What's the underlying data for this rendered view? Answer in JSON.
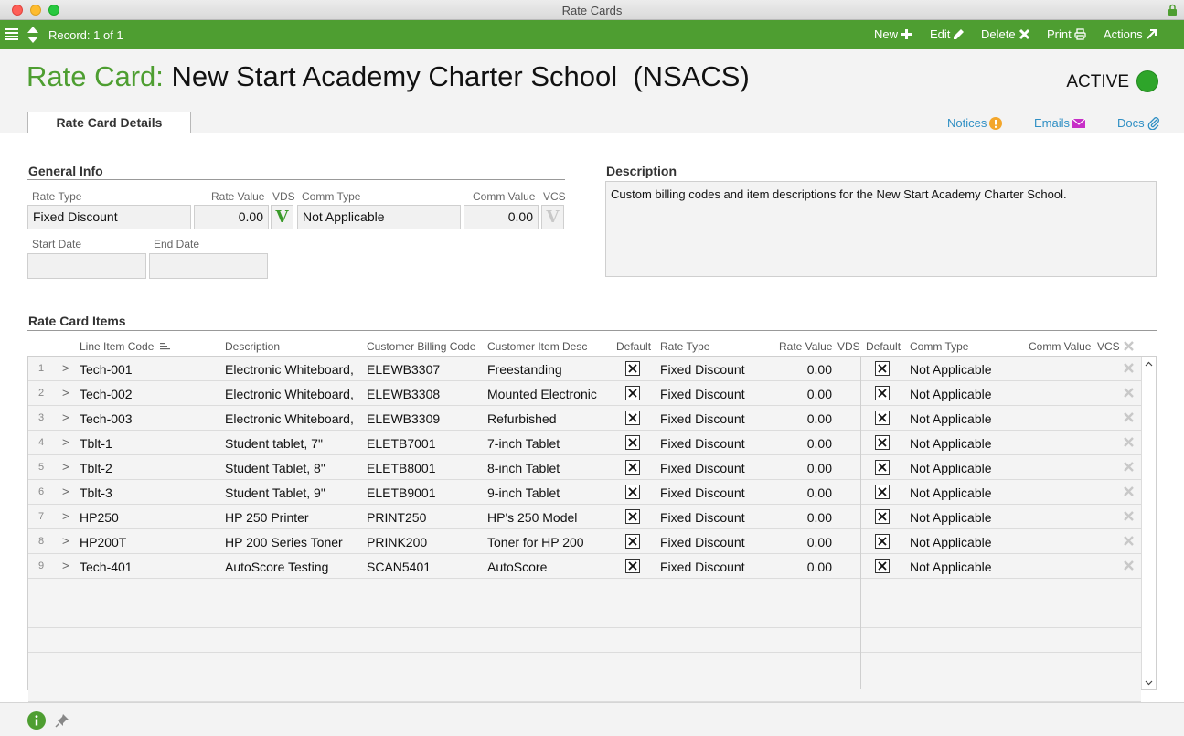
{
  "window": {
    "title": "Rate Cards"
  },
  "toolbar": {
    "record": "Record: 1 of 1",
    "new_label": "New",
    "edit_label": "Edit",
    "delete_label": "Delete",
    "print_label": "Print",
    "actions_label": "Actions"
  },
  "header": {
    "label": "Rate Card:",
    "name": "New Start Academy Charter School  (NSACS)",
    "status": "ACTIVE",
    "status_color": "#2ea52a"
  },
  "tabs": [
    {
      "label": "Rate Card Details"
    }
  ],
  "links": {
    "notices": "Notices",
    "emails": "Emails",
    "docs": "Docs"
  },
  "general": {
    "title": "General Info",
    "rate_type_label": "Rate Type",
    "rate_type": "Fixed Discount",
    "rate_value_label": "Rate Value",
    "rate_value": "0.00",
    "vds_label": "VDS",
    "vds_mark": "V",
    "comm_type_label": "Comm Type",
    "comm_type": "Not Applicable",
    "comm_value_label": "Comm Value",
    "comm_value": "0.00",
    "vcs_label": "VCS",
    "vcs_mark": "V",
    "start_date_label": "Start Date",
    "start_date": "",
    "end_date_label": "End Date",
    "end_date": ""
  },
  "description": {
    "title": "Description",
    "text": "Custom billing codes and item descriptions for the New Start Academy Charter School."
  },
  "items": {
    "title": "Rate Card Items",
    "columns": {
      "line_item_code": "Line Item Code",
      "description": "Description",
      "billing_code": "Customer Billing Code",
      "item_desc": "Customer Item Desc",
      "default1": "Default",
      "rate_type": "Rate Type",
      "rate_value": "Rate Value",
      "vds": "VDS",
      "default2": "Default",
      "comm_type": "Comm Type",
      "comm_value": "Comm Value",
      "vcs": "VCS"
    },
    "rows": [
      {
        "num": "1",
        "code": "Tech-001",
        "desc": "Electronic Whiteboard,",
        "billing": "ELEWB3307",
        "item_desc": "Freestanding",
        "rate_type": "Fixed Discount",
        "rate_value": "0.00",
        "comm_type": "Not Applicable"
      },
      {
        "num": "2",
        "code": "Tech-002",
        "desc": "Electronic Whiteboard,",
        "billing": "ELEWB3308",
        "item_desc": "Mounted Electronic",
        "rate_type": "Fixed Discount",
        "rate_value": "0.00",
        "comm_type": "Not Applicable"
      },
      {
        "num": "3",
        "code": "Tech-003",
        "desc": "Electronic Whiteboard,",
        "billing": "ELEWB3309",
        "item_desc": "Refurbished",
        "rate_type": "Fixed Discount",
        "rate_value": "0.00",
        "comm_type": "Not Applicable"
      },
      {
        "num": "4",
        "code": "Tblt-1",
        "desc": "Student tablet, 7\"",
        "billing": "ELETB7001",
        "item_desc": "7-inch Tablet",
        "rate_type": "Fixed Discount",
        "rate_value": "0.00",
        "comm_type": "Not Applicable"
      },
      {
        "num": "5",
        "code": "Tblt-2",
        "desc": "Student Tablet, 8\"",
        "billing": "ELETB8001",
        "item_desc": "8-inch Tablet",
        "rate_type": "Fixed Discount",
        "rate_value": "0.00",
        "comm_type": "Not Applicable"
      },
      {
        "num": "6",
        "code": "Tblt-3",
        "desc": "Student Tablet, 9\"",
        "billing": "ELETB9001",
        "item_desc": "9-inch Tablet",
        "rate_type": "Fixed Discount",
        "rate_value": "0.00",
        "comm_type": "Not Applicable"
      },
      {
        "num": "7",
        "code": "HP250",
        "desc": "HP 250 Printer",
        "billing": "PRINT250",
        "item_desc": "HP's 250 Model",
        "rate_type": "Fixed Discount",
        "rate_value": "0.00",
        "comm_type": "Not Applicable"
      },
      {
        "num": "8",
        "code": "HP200T",
        "desc": "HP 200 Series Toner",
        "billing": "PRINK200",
        "item_desc": "Toner for HP 200",
        "rate_type": "Fixed Discount",
        "rate_value": "0.00",
        "comm_type": "Not Applicable"
      },
      {
        "num": "9",
        "code": "Tech-401",
        "desc": "AutoScore Testing",
        "billing": "SCAN5401",
        "item_desc": "AutoScore",
        "rate_type": "Fixed Discount",
        "rate_value": "0.00",
        "comm_type": "Not Applicable"
      }
    ],
    "empty_rows": 5
  },
  "colors": {
    "accent": "#4e9e31",
    "link": "#2f8fc4",
    "vds_on": "#3a9a2a",
    "vcs_off": "#c8c8c8"
  }
}
